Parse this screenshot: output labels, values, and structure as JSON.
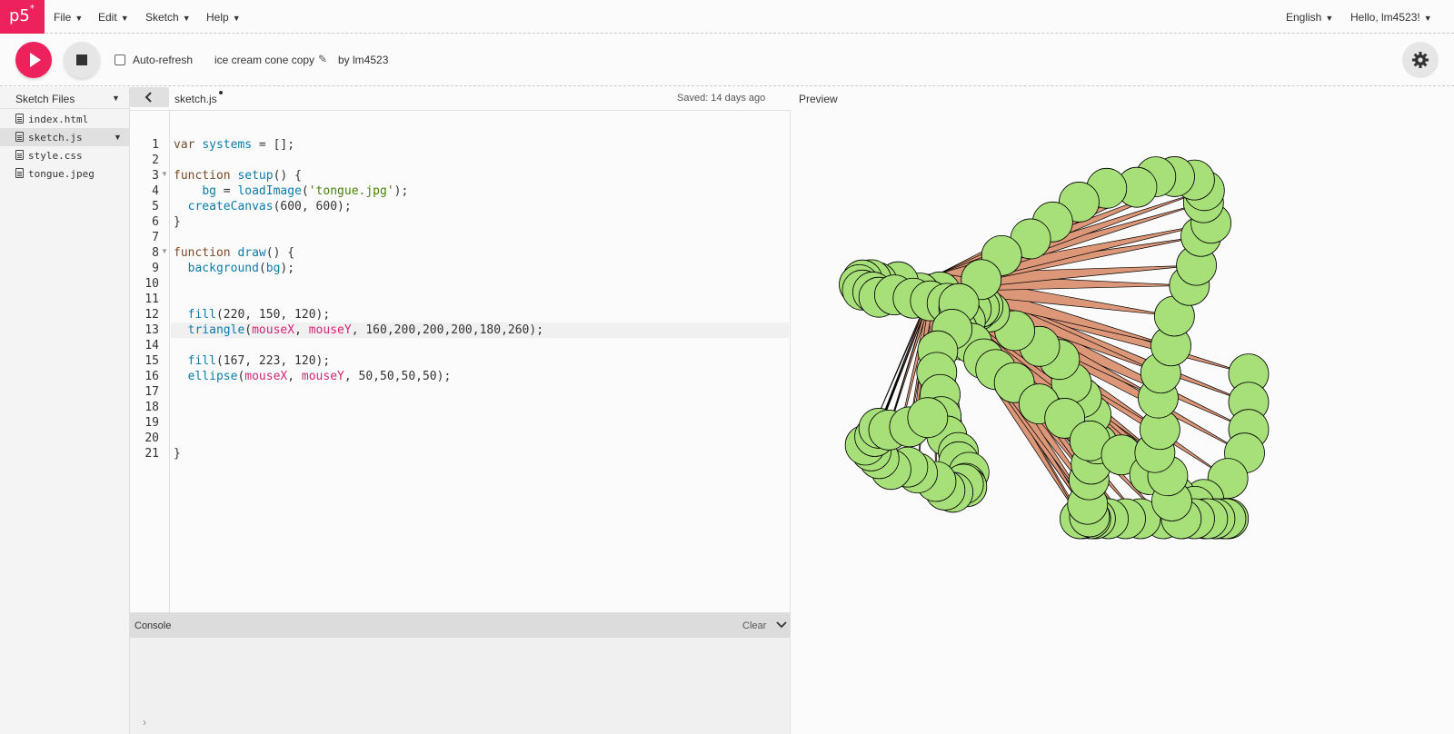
{
  "nav": {
    "logo": "p5",
    "logo_sup": "*",
    "menus": [
      "File",
      "Edit",
      "Sketch",
      "Help"
    ],
    "language": "English",
    "user_greeting": "Hello, lm4523!"
  },
  "toolbar": {
    "auto_refresh_label": "Auto-refresh",
    "auto_refresh_checked": false,
    "sketch_name": "ice cream cone copy",
    "owner": "by lm4523"
  },
  "sidebar": {
    "title": "Sketch Files",
    "files": [
      {
        "name": "index.html",
        "active": false
      },
      {
        "name": "sketch.js",
        "active": true
      },
      {
        "name": "style.css",
        "active": false
      },
      {
        "name": "tongue.jpeg",
        "active": false
      }
    ]
  },
  "editor": {
    "tab": "sketch.js",
    "saved_status": "Saved: 14 days ago",
    "active_line": 13,
    "lines": [
      "",
      "var systems = [];",
      "",
      "function setup() {",
      "    bg = loadImage('tongue.jpg');",
      "  createCanvas(600, 600);",
      "}",
      "",
      "function draw() {",
      "  background(bg);",
      "",
      "",
      "  fill(220, 150, 120);",
      "  triangle(mouseX, mouseY, 160,200,200,200,180,260);",
      "",
      "  fill(167, 223, 120);",
      "  ellipse(mouseX, mouseY, 50,50,50,50);",
      "",
      "",
      "",
      "",
      "}"
    ]
  },
  "console": {
    "title": "Console",
    "clear_label": "Clear",
    "prompt": "›"
  },
  "preview": {
    "title": "Preview",
    "fill_triangle": "#dc9678",
    "fill_ellipse": "#a7df78"
  },
  "colors": {
    "accent": "#ed225d"
  }
}
